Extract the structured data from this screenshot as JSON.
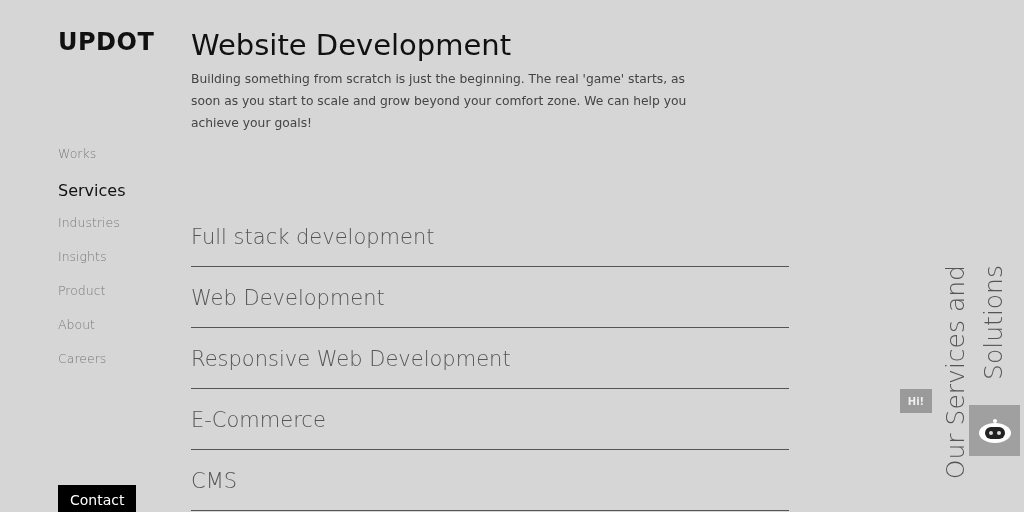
{
  "logo": "UPDOT",
  "nav": [
    {
      "label": "Works",
      "selected": false
    },
    {
      "label": "Services",
      "selected": true
    },
    {
      "label": "Industries",
      "selected": false
    },
    {
      "label": "Insights",
      "selected": false
    },
    {
      "label": "Product",
      "selected": false
    },
    {
      "label": "About",
      "selected": false
    },
    {
      "label": "Careers",
      "selected": false
    }
  ],
  "contact_button": "Contact",
  "heading": "Website Development",
  "intro": "Building something from scratch is just the beginning. The real 'game' starts, as soon as you start to scale and grow beyond your comfort zone. We can help you achieve your goals!",
  "services": [
    "Full stack development",
    "Web Development",
    "Responsive Web Development",
    "E-Commerce",
    "CMS"
  ],
  "side_title": [
    "Our Services and",
    "Solutions"
  ],
  "chat": {
    "bubble": "Hi!"
  }
}
